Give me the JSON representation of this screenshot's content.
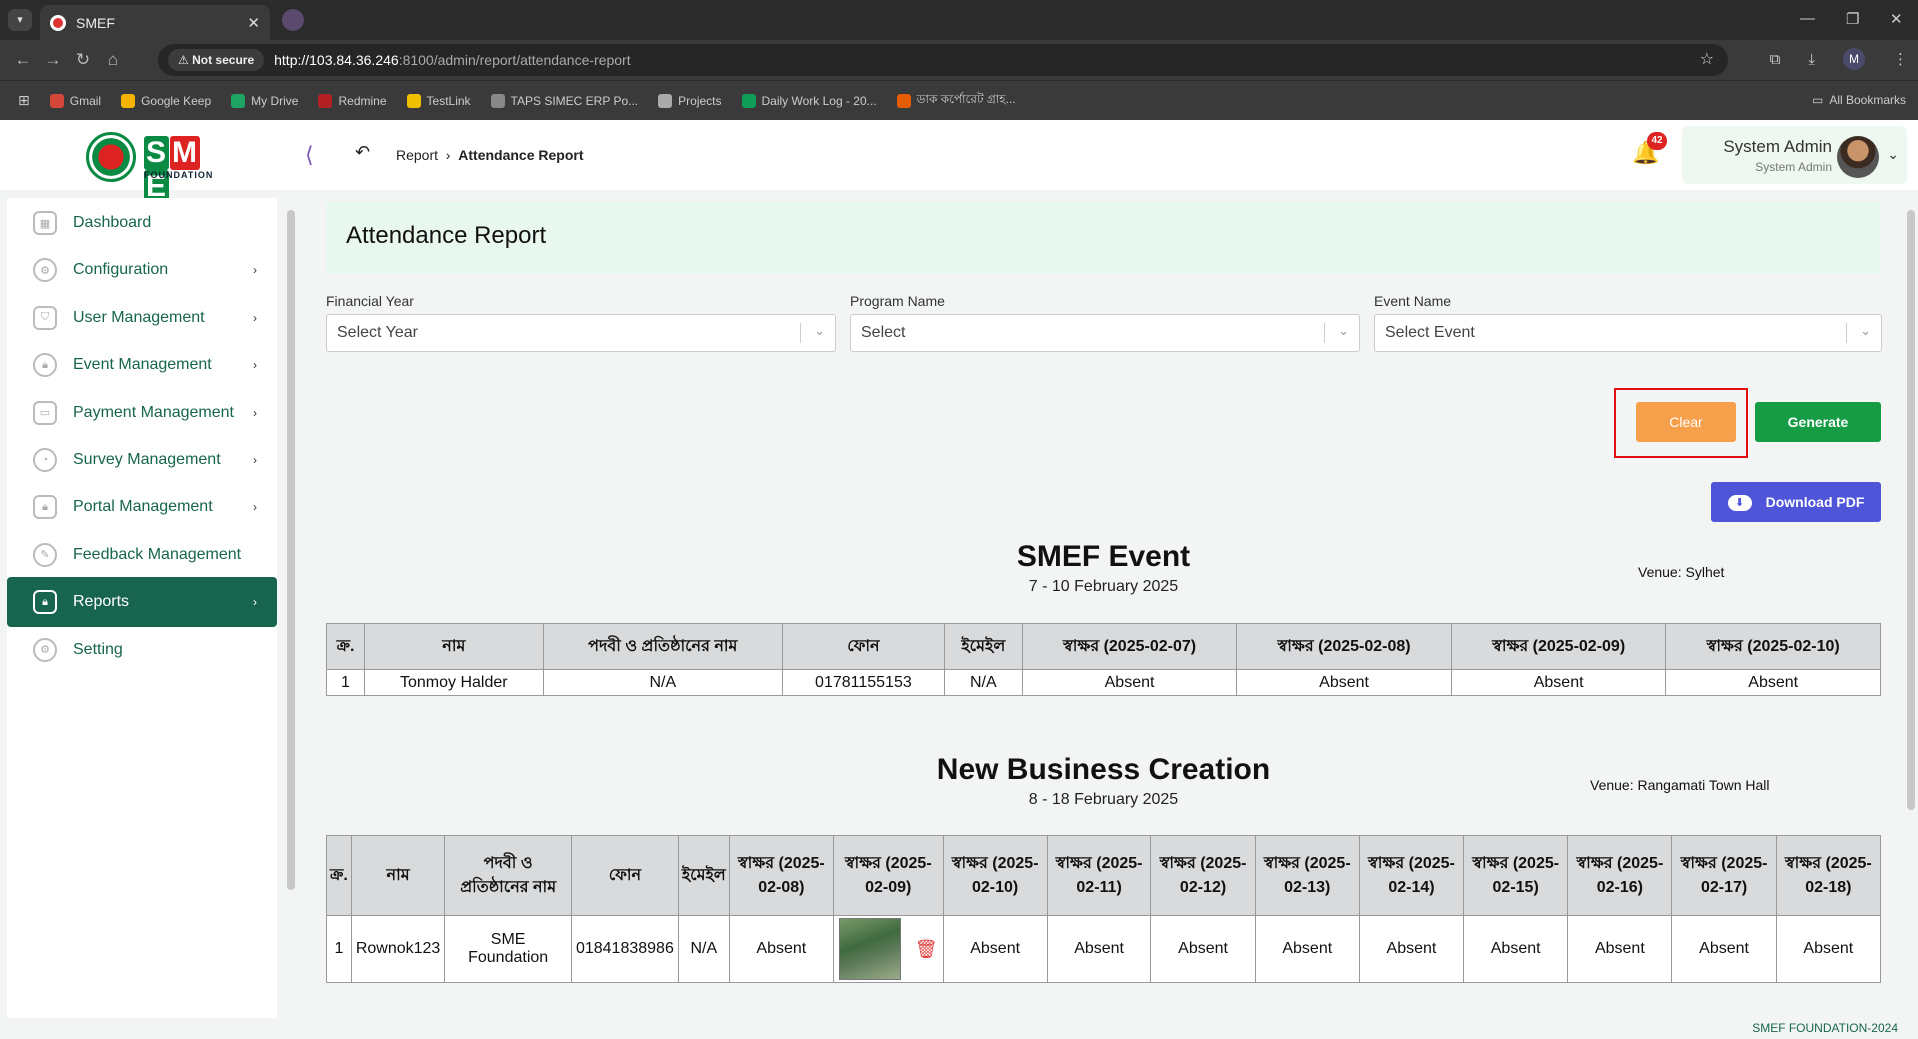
{
  "browser": {
    "tab_title": "SMEF",
    "not_secure": "Not secure",
    "url_host": "http://103.84.36.246",
    "url_rest": ":8100/admin/report/attendance-report",
    "profile_letter": "M",
    "bookmarks": [
      {
        "label": "Gmail",
        "color": "#d44638"
      },
      {
        "label": "Google Keep",
        "color": "#f4b400"
      },
      {
        "label": "My Drive",
        "color": "#1fa463"
      },
      {
        "label": "Redmine",
        "color": "#b32024"
      },
      {
        "label": "TestLink",
        "color": "#f0c000"
      },
      {
        "label": "TAPS SIMEC ERP Po...",
        "color": "#888888"
      },
      {
        "label": "Projects",
        "color": "#aaaaaa"
      },
      {
        "label": "Daily Work Log - 20...",
        "color": "#0f9d58"
      },
      {
        "label": "ডাক কর্পোরেট গ্রাহ...",
        "color": "#e65c00"
      }
    ],
    "all_bookmarks": "All Bookmarks"
  },
  "header": {
    "logo_text": "SME",
    "logo_sub": "FOUNDATION",
    "breadcrumb_parent": "Report",
    "breadcrumb_current": "Attendance Report",
    "notification_count": "42",
    "user_name": "System Admin",
    "user_role": "System Admin"
  },
  "sidebar": {
    "items": [
      {
        "label": "Dashboard",
        "icon": "grid-icon",
        "has_arrow": false
      },
      {
        "label": "Configuration",
        "icon": "config-icon",
        "has_arrow": true
      },
      {
        "label": "User Management",
        "icon": "user-shield-icon",
        "has_arrow": true
      },
      {
        "label": "Event Management",
        "icon": "lock-icon",
        "has_arrow": true
      },
      {
        "label": "Payment Management",
        "icon": "payment-icon",
        "has_arrow": true
      },
      {
        "label": "Survey Management",
        "icon": "pie-icon",
        "has_arrow": true
      },
      {
        "label": "Portal Management",
        "icon": "lock-icon",
        "has_arrow": true
      },
      {
        "label": "Feedback Management",
        "icon": "feedback-icon",
        "has_arrow": false
      },
      {
        "label": "Reports",
        "icon": "lock-icon",
        "has_arrow": true,
        "active": true
      },
      {
        "label": "Setting",
        "icon": "gear-icon",
        "has_arrow": false
      }
    ],
    "active_color": "#17654e"
  },
  "page": {
    "title": "Attendance Report",
    "filters": {
      "financial_year_label": "Financial Year",
      "financial_year_placeholder": "Select Year",
      "program_label": "Program Name",
      "program_placeholder": "Select",
      "event_label": "Event Name",
      "event_placeholder": "Select Event"
    },
    "clear_label": "Clear",
    "generate_label": "Generate",
    "download_label": "Download PDF"
  },
  "events": [
    {
      "title": "SMEF Event",
      "dates": "7 - 10 February 2025",
      "venue": "Venue: Sylhet",
      "columns": [
        "ক্র.",
        "নাম",
        "পদবী ও প্রতিষ্ঠানের নাম",
        "ফোন",
        "ইমেইল",
        "স্বাক্ষর (2025-02-07)",
        "স্বাক্ষর (2025-02-08)",
        "স্বাক্ষর (2025-02-09)",
        "স্বাক্ষর (2025-02-10)"
      ],
      "rows": [
        [
          "1",
          "Tonmoy Halder",
          "N/A",
          "01781155153",
          "N/A",
          "Absent",
          "Absent",
          "Absent",
          "Absent"
        ]
      ]
    },
    {
      "title": "New Business Creation",
      "dates": "8 - 18 February 2025",
      "venue": "Venue: Rangamati Town Hall",
      "columns": [
        "ক্র.",
        "নাম",
        "পদবী ও প্রতিষ্ঠানের নাম",
        "ফোন",
        "ইমেইল",
        "স্বাক্ষর (2025-02-08)",
        "স্বাক্ষর (2025-02-09)",
        "স্বাক্ষর (2025-02-10)",
        "স্বাক্ষর (2025-02-11)",
        "স্বাক্ষর (2025-02-12)",
        "স্বাক্ষর (2025-02-13)",
        "স্বাক্ষর (2025-02-14)",
        "স্বাক্ষর (2025-02-15)",
        "স্বাক্ষর (2025-02-16)",
        "স্বাক্ষর (2025-02-17)",
        "স্বাক্ষর (2025-02-18)"
      ],
      "rows": [
        [
          "1",
          "Rownok123",
          "SME Foundation",
          "01841838986",
          "N/A",
          "Absent",
          "",
          "Absent",
          "Absent",
          "Absent",
          "Absent",
          "Absent",
          "Absent",
          "Absent",
          "Absent",
          "Absent"
        ]
      ]
    }
  ],
  "footer": "SMEF FOUNDATION-2024"
}
